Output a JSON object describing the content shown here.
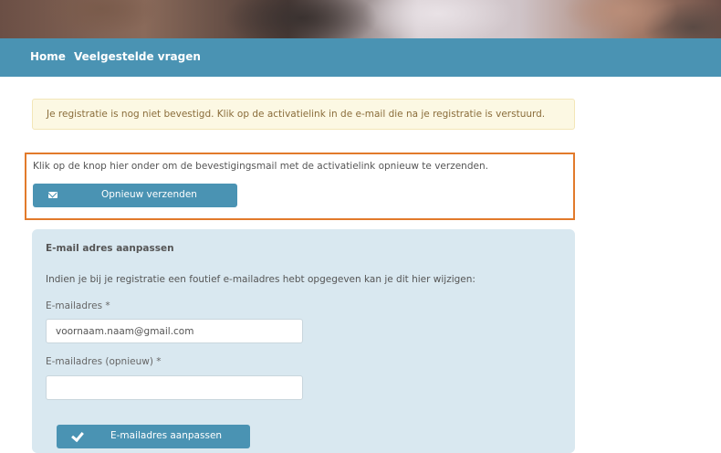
{
  "nav": {
    "items": [
      {
        "label": "Home"
      },
      {
        "label": "Veelgestelde vragen"
      }
    ]
  },
  "alert": {
    "text": "Je registratie is nog niet bevestigd. Klik op de activatielink in de e-mail die na je registratie is verstuurd."
  },
  "resend": {
    "instruction": "Klik op de knop hier onder om de bevestigingsmail met de activatielink opnieuw te verzenden.",
    "button_label": "Opnieuw verzenden",
    "button_icon": "envelope-icon"
  },
  "email_panel": {
    "title": "E-mail adres aanpassen",
    "info": "Indien je bij je registratie een foutief e-mailadres hebt opgegeven kan je dit hier wijzigen:",
    "email_label": "E-mailadres *",
    "email_value": "voornaam.naam@gmail.com",
    "email_repeat_label": "E-mailadres (opnieuw) *",
    "email_repeat_value": "",
    "submit_label": "E-mailadres aanpassen",
    "submit_icon": "check-icon"
  },
  "colors": {
    "navbar": "#4a93b3",
    "primary_button": "#4a93b3",
    "alert_background": "#fcf8e3",
    "alert_text": "#8a6d3b",
    "highlight_border": "#e27a2b",
    "panel_background": "#d9e8f0"
  }
}
